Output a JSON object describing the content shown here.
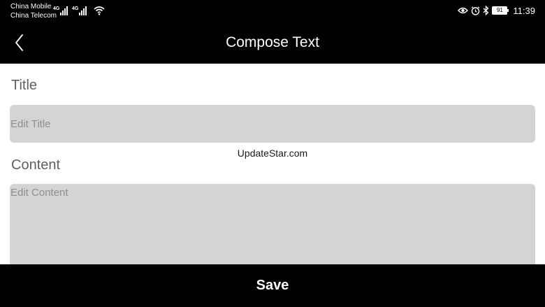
{
  "status_bar": {
    "carrier_1": "China Mobile",
    "carrier_2": "China Telecom",
    "network_1": "4G",
    "network_2": "4G",
    "battery_level": "91",
    "time": "11:39",
    "icons": [
      "signal-icon",
      "signal-icon",
      "wifi-icon",
      "eye-comfort-icon",
      "alarm-icon",
      "bluetooth-icon",
      "battery-icon"
    ]
  },
  "header": {
    "title": "Compose Text",
    "back_icon": "chevron-left-icon"
  },
  "form": {
    "title_label": "Title",
    "title_placeholder": "Edit Title",
    "title_value": "",
    "content_label": "Content",
    "content_placeholder": "Edit Content",
    "content_value": ""
  },
  "watermark": "UpdateStar.com",
  "footer": {
    "save_label": "Save"
  },
  "colors": {
    "bar_background": "#000000",
    "field_background": "#d4d4d4",
    "label_text": "#5f5f5f",
    "placeholder_text": "#8e8e8e"
  }
}
